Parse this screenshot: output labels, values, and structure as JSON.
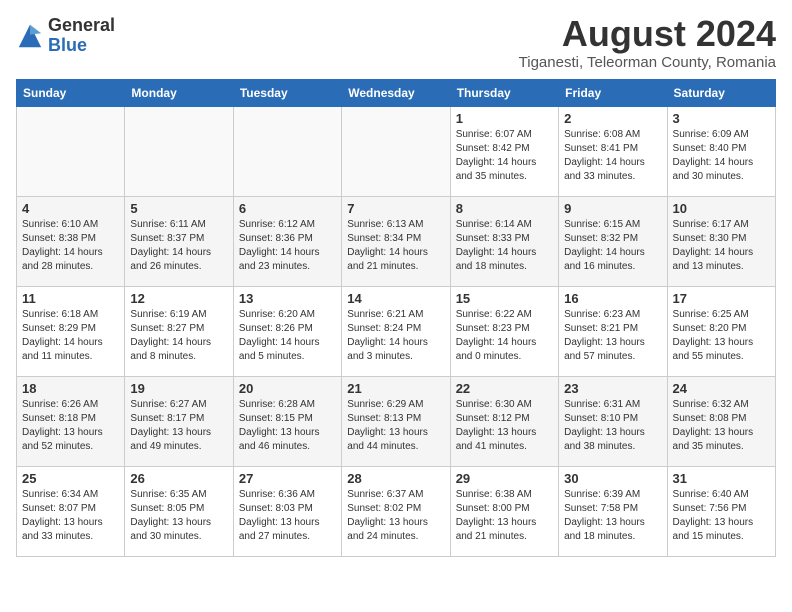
{
  "header": {
    "logo_general": "General",
    "logo_blue": "Blue",
    "month_year": "August 2024",
    "location": "Tiganesti, Teleorman County, Romania"
  },
  "weekdays": [
    "Sunday",
    "Monday",
    "Tuesday",
    "Wednesday",
    "Thursday",
    "Friday",
    "Saturday"
  ],
  "weeks": [
    [
      {
        "day": "",
        "info": ""
      },
      {
        "day": "",
        "info": ""
      },
      {
        "day": "",
        "info": ""
      },
      {
        "day": "",
        "info": ""
      },
      {
        "day": "1",
        "info": "Sunrise: 6:07 AM\nSunset: 8:42 PM\nDaylight: 14 hours\nand 35 minutes."
      },
      {
        "day": "2",
        "info": "Sunrise: 6:08 AM\nSunset: 8:41 PM\nDaylight: 14 hours\nand 33 minutes."
      },
      {
        "day": "3",
        "info": "Sunrise: 6:09 AM\nSunset: 8:40 PM\nDaylight: 14 hours\nand 30 minutes."
      }
    ],
    [
      {
        "day": "4",
        "info": "Sunrise: 6:10 AM\nSunset: 8:38 PM\nDaylight: 14 hours\nand 28 minutes."
      },
      {
        "day": "5",
        "info": "Sunrise: 6:11 AM\nSunset: 8:37 PM\nDaylight: 14 hours\nand 26 minutes."
      },
      {
        "day": "6",
        "info": "Sunrise: 6:12 AM\nSunset: 8:36 PM\nDaylight: 14 hours\nand 23 minutes."
      },
      {
        "day": "7",
        "info": "Sunrise: 6:13 AM\nSunset: 8:34 PM\nDaylight: 14 hours\nand 21 minutes."
      },
      {
        "day": "8",
        "info": "Sunrise: 6:14 AM\nSunset: 8:33 PM\nDaylight: 14 hours\nand 18 minutes."
      },
      {
        "day": "9",
        "info": "Sunrise: 6:15 AM\nSunset: 8:32 PM\nDaylight: 14 hours\nand 16 minutes."
      },
      {
        "day": "10",
        "info": "Sunrise: 6:17 AM\nSunset: 8:30 PM\nDaylight: 14 hours\nand 13 minutes."
      }
    ],
    [
      {
        "day": "11",
        "info": "Sunrise: 6:18 AM\nSunset: 8:29 PM\nDaylight: 14 hours\nand 11 minutes."
      },
      {
        "day": "12",
        "info": "Sunrise: 6:19 AM\nSunset: 8:27 PM\nDaylight: 14 hours\nand 8 minutes."
      },
      {
        "day": "13",
        "info": "Sunrise: 6:20 AM\nSunset: 8:26 PM\nDaylight: 14 hours\nand 5 minutes."
      },
      {
        "day": "14",
        "info": "Sunrise: 6:21 AM\nSunset: 8:24 PM\nDaylight: 14 hours\nand 3 minutes."
      },
      {
        "day": "15",
        "info": "Sunrise: 6:22 AM\nSunset: 8:23 PM\nDaylight: 14 hours\nand 0 minutes."
      },
      {
        "day": "16",
        "info": "Sunrise: 6:23 AM\nSunset: 8:21 PM\nDaylight: 13 hours\nand 57 minutes."
      },
      {
        "day": "17",
        "info": "Sunrise: 6:25 AM\nSunset: 8:20 PM\nDaylight: 13 hours\nand 55 minutes."
      }
    ],
    [
      {
        "day": "18",
        "info": "Sunrise: 6:26 AM\nSunset: 8:18 PM\nDaylight: 13 hours\nand 52 minutes."
      },
      {
        "day": "19",
        "info": "Sunrise: 6:27 AM\nSunset: 8:17 PM\nDaylight: 13 hours\nand 49 minutes."
      },
      {
        "day": "20",
        "info": "Sunrise: 6:28 AM\nSunset: 8:15 PM\nDaylight: 13 hours\nand 46 minutes."
      },
      {
        "day": "21",
        "info": "Sunrise: 6:29 AM\nSunset: 8:13 PM\nDaylight: 13 hours\nand 44 minutes."
      },
      {
        "day": "22",
        "info": "Sunrise: 6:30 AM\nSunset: 8:12 PM\nDaylight: 13 hours\nand 41 minutes."
      },
      {
        "day": "23",
        "info": "Sunrise: 6:31 AM\nSunset: 8:10 PM\nDaylight: 13 hours\nand 38 minutes."
      },
      {
        "day": "24",
        "info": "Sunrise: 6:32 AM\nSunset: 8:08 PM\nDaylight: 13 hours\nand 35 minutes."
      }
    ],
    [
      {
        "day": "25",
        "info": "Sunrise: 6:34 AM\nSunset: 8:07 PM\nDaylight: 13 hours\nand 33 minutes."
      },
      {
        "day": "26",
        "info": "Sunrise: 6:35 AM\nSunset: 8:05 PM\nDaylight: 13 hours\nand 30 minutes."
      },
      {
        "day": "27",
        "info": "Sunrise: 6:36 AM\nSunset: 8:03 PM\nDaylight: 13 hours\nand 27 minutes."
      },
      {
        "day": "28",
        "info": "Sunrise: 6:37 AM\nSunset: 8:02 PM\nDaylight: 13 hours\nand 24 minutes."
      },
      {
        "day": "29",
        "info": "Sunrise: 6:38 AM\nSunset: 8:00 PM\nDaylight: 13 hours\nand 21 minutes."
      },
      {
        "day": "30",
        "info": "Sunrise: 6:39 AM\nSunset: 7:58 PM\nDaylight: 13 hours\nand 18 minutes."
      },
      {
        "day": "31",
        "info": "Sunrise: 6:40 AM\nSunset: 7:56 PM\nDaylight: 13 hours\nand 15 minutes."
      }
    ]
  ]
}
